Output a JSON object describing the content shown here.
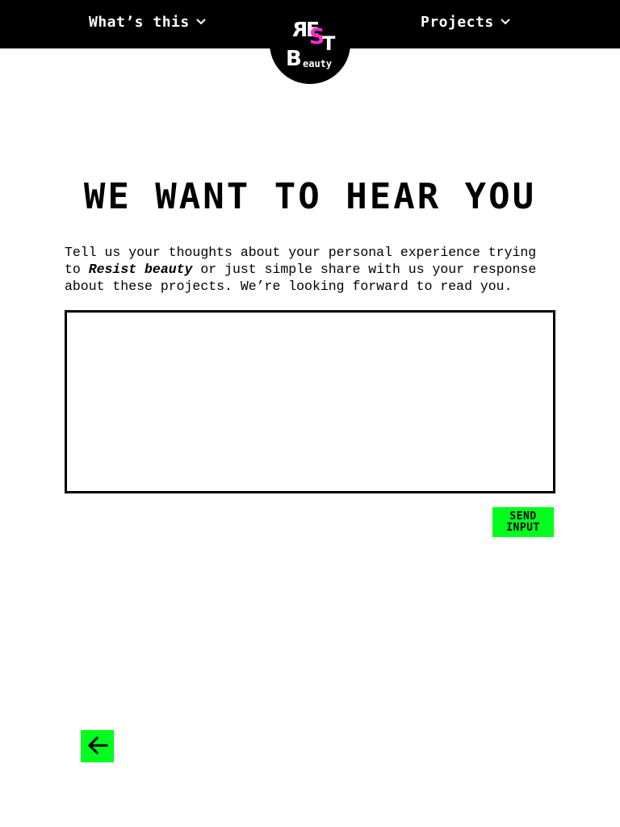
{
  "header": {
    "nav_left": {
      "label": "What’s this",
      "icon": "chevron-down-icon"
    },
    "nav_right": {
      "label": "Projects",
      "icon": "chevron-down-icon"
    },
    "logo": {
      "letters": {
        "r": "R",
        "e": "E",
        "s": "S",
        "t": "T",
        "b": "B",
        "beauty": "eauty"
      },
      "accent_color": "#ff2bd6"
    }
  },
  "main": {
    "title": "WE WANT TO HEAR YOU",
    "intro_before": "Tell us your thoughts about your personal experience trying to ",
    "intro_emphasis": "Resist beauty",
    "intro_after": " or just simple share with us your response about these projects. We’re looking forward to read you.",
    "textarea_value": "",
    "send_line1": "SEND",
    "send_line2": "INPUT"
  },
  "footer": {
    "back_icon": "arrow-left-icon"
  },
  "colors": {
    "header_bg": "#000000",
    "accent_green": "#00ff1e",
    "logo_pink": "#ff2bd6"
  }
}
